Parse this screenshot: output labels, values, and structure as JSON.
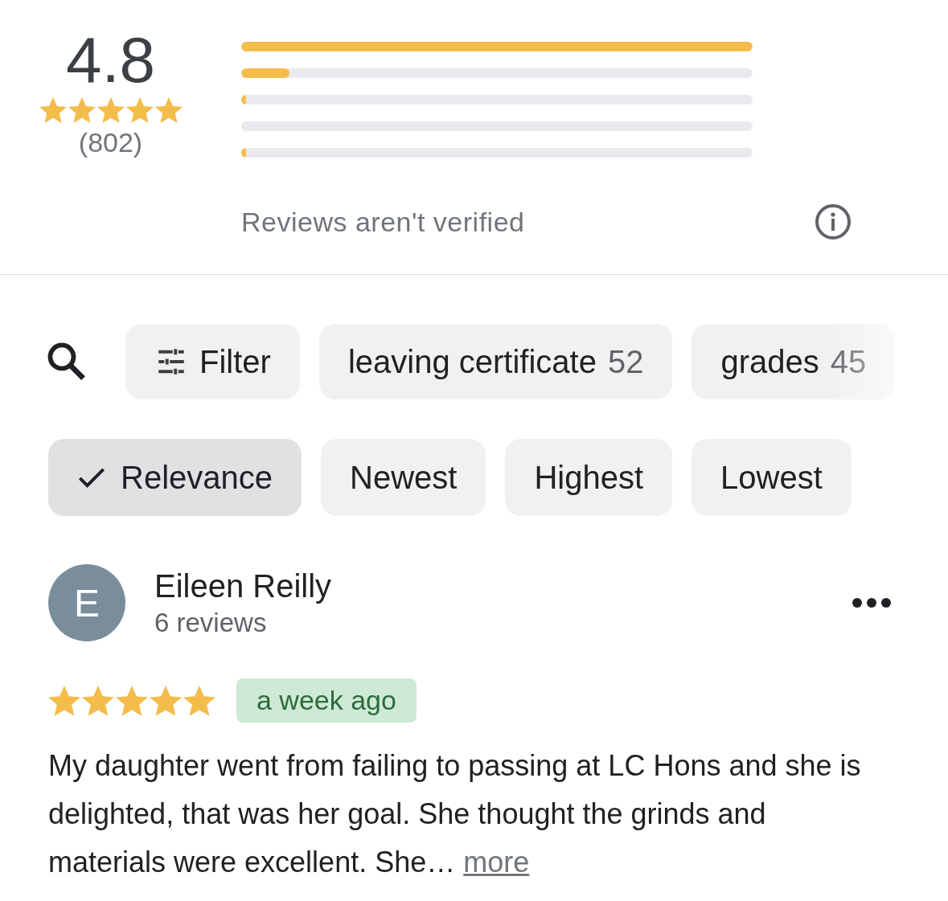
{
  "summary": {
    "rating": "4.8",
    "stars": 5,
    "count": "(802)",
    "bars": [
      {
        "level": 1
      },
      {
        "level": 0.095
      },
      {
        "level": 0.01
      },
      {
        "level": 0
      },
      {
        "level": 0.01
      }
    ],
    "notice": "Reviews aren't verified"
  },
  "topics": [
    {
      "kind": "filter",
      "label": "Filter"
    },
    {
      "kind": "topic",
      "label": "leaving certificate",
      "count": "52"
    },
    {
      "kind": "topic",
      "label": "grades",
      "count": "45"
    }
  ],
  "sort": [
    {
      "label": "Relevance",
      "selected": true
    },
    {
      "label": "Newest",
      "selected": false
    },
    {
      "label": "Highest",
      "selected": false
    },
    {
      "label": "Lowest",
      "selected": false
    }
  ],
  "review": {
    "initial": "E",
    "name": "Eileen Reilly",
    "reviews": "6 reviews",
    "stars": 5,
    "time": "a week ago",
    "text": "My daughter went from failing to passing at LC Hons and she is delighted, that was her goal. She thought the grinds and materials were excellent. She…",
    "more": "more"
  }
}
